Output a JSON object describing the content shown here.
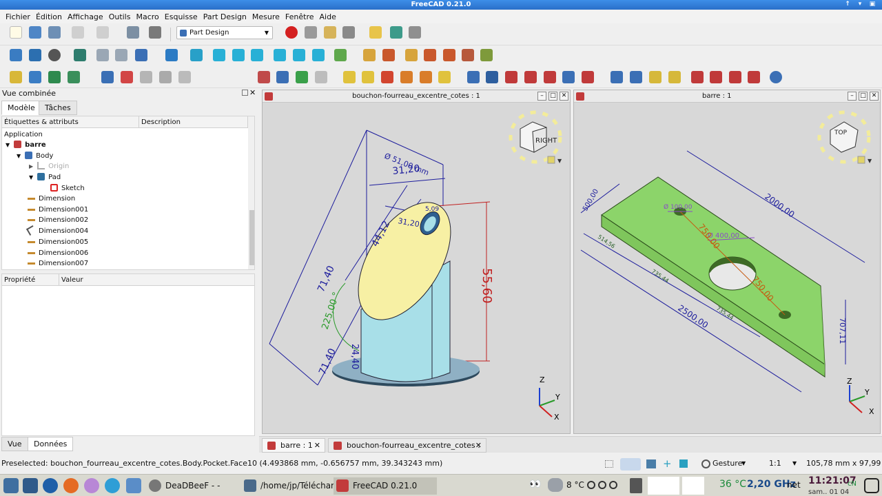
{
  "window": {
    "title": "FreeCAD 0.21.0"
  },
  "menu": [
    "Fichier",
    "Édition",
    "Affichage",
    "Outils",
    "Macro",
    "Esquisse",
    "Part Design",
    "Mesure",
    "Fenêtre",
    "Aide"
  ],
  "toolbar": {
    "workbench": "Part Design"
  },
  "combo_view": {
    "title": "Vue combinée",
    "tabs": [
      "Modèle",
      "Tâches"
    ],
    "tree_headers": [
      "Étiquettes & attributs",
      "Description"
    ],
    "tree": [
      {
        "label": "Application",
        "icon": "none"
      },
      {
        "label": "barre",
        "icon": "document-icon"
      },
      {
        "label": "Body",
        "icon": "body-icon"
      },
      {
        "label": "Origin",
        "icon": "origin-icon"
      },
      {
        "label": "Pad",
        "icon": "pad-icon"
      },
      {
        "label": "Sketch",
        "icon": "sketch-icon"
      },
      {
        "label": "Dimension",
        "icon": "dimension-icon"
      },
      {
        "label": "Dimension001",
        "icon": "dimension-icon"
      },
      {
        "label": "Dimension002",
        "icon": "dimension-icon"
      },
      {
        "label": "Dimension004",
        "icon": "angle-dimension-icon"
      },
      {
        "label": "Dimension005",
        "icon": "dimension-icon"
      },
      {
        "label": "Dimension006",
        "icon": "dimension-icon"
      },
      {
        "label": "Dimension007",
        "icon": "dimension-icon"
      }
    ],
    "prop_headers": [
      "Propriété",
      "Valeur"
    ],
    "bottom_tabs": [
      "Vue",
      "Données"
    ]
  },
  "views": {
    "left": {
      "title": "bouchon-fourreau_excentre_cotes : 1",
      "cube_face": "RIGHT",
      "dims": [
        "Ø 51,00 mm",
        "31,20",
        "44,12",
        "31,20",
        "5,09",
        "71,40",
        "71,40",
        "225,00 °",
        "24,40",
        "55,60"
      ],
      "axes": [
        "Z",
        "Y",
        "X"
      ]
    },
    "right": {
      "title": "barre : 1",
      "cube_face": "TOP",
      "dims": [
        "500,00",
        "Ø 100,00",
        "Ø 400,00",
        "2000,00",
        "750,00",
        "750,00",
        "514,56",
        "735,44",
        "735,44",
        "2500,00",
        "707,11"
      ],
      "axes": [
        "Z",
        "Y",
        "X"
      ]
    }
  },
  "doc_tabs": [
    "barre : 1",
    "bouchon-fourreau_excentre_cotes : 1"
  ],
  "status": {
    "message": "Preselected: bouchon_fourreau_excentre_cotes.Body.Pocket.Face10 (4.493868 mm, -0.656757 mm, 39.343243 mm)",
    "nav_style": "Gesture",
    "scale": "1:1",
    "dimensions": "105,78 mm x 97,99 mm"
  },
  "taskbar": {
    "tasks": [
      "DeaDBeeF - - Mon...",
      "/home/jp/Téléchar...",
      "FreeCAD 0.21.0"
    ],
    "weather": "8 °C",
    "cpu_temp": "36 °C",
    "cpu_freq": "2,20 GHz",
    "net": "net",
    "time": "11:21:07",
    "date": "sam.. 01 04"
  }
}
